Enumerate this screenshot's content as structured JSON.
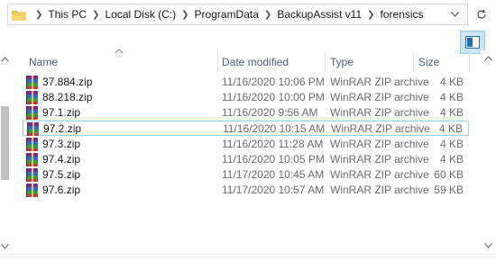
{
  "address": {
    "crumbs": [
      "This PC",
      "Local Disk (C:)",
      "ProgramData",
      "BackupAssist v11",
      "forensics"
    ]
  },
  "columns": {
    "name": "Name",
    "date": "Date modified",
    "type": "Type",
    "size": "Size"
  },
  "files": [
    {
      "name": "37.884.zip",
      "date": "11/16/2020 10:06 PM",
      "type": "WinRAR ZIP archive",
      "size": "4 KB"
    },
    {
      "name": "88.218.zip",
      "date": "11/16/2020 10:00 PM",
      "type": "WinRAR ZIP archive",
      "size": "4 KB"
    },
    {
      "name": "97.1.zip",
      "date": "11/16/2020 9:56 AM",
      "type": "WinRAR ZIP archive",
      "size": "4 KB"
    },
    {
      "name": "97.2.zip",
      "date": "11/16/2020 10:15 AM",
      "type": "WinRAR ZIP archive",
      "size": "4 KB",
      "selected": true
    },
    {
      "name": "97.3.zip",
      "date": "11/16/2020 11:28 AM",
      "type": "WinRAR ZIP archive",
      "size": "4 KB"
    },
    {
      "name": "97.4.zip",
      "date": "11/16/2020 10:05 PM",
      "type": "WinRAR ZIP archive",
      "size": "4 KB"
    },
    {
      "name": "97.5.zip",
      "date": "11/17/2020 10:45 AM",
      "type": "WinRAR ZIP archive",
      "size": "60 KB"
    },
    {
      "name": "97.6.zip",
      "date": "11/17/2020 10:57 AM",
      "type": "WinRAR ZIP archive",
      "size": "59 KB"
    }
  ],
  "icons": {
    "folder": "folder-icon",
    "refresh": "refresh-icon",
    "view": "details-view-icon",
    "file": "winrar-archive-icon"
  },
  "colors": {
    "header_text": "#4c607a",
    "selection_border": "#99d1ff",
    "view_active": "#cce4f7"
  }
}
